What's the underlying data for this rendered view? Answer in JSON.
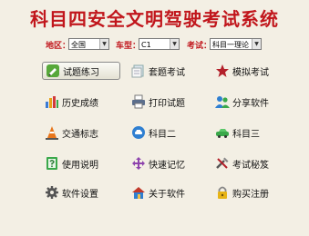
{
  "title": "科目四安全文明驾驶考试系统",
  "selectors": {
    "region_label": "地区：",
    "region_value": "全国",
    "car_label": "车型：",
    "car_value": "C1",
    "exam_label": "考试：",
    "exam_value": "科目一理论"
  },
  "buttons": [
    {
      "label": "试题练习",
      "icon": "pencil-icon"
    },
    {
      "label": "套题考试",
      "icon": "paper-stack-icon"
    },
    {
      "label": "模拟考试",
      "icon": "star-icon"
    },
    {
      "label": "历史成绩",
      "icon": "bar-chart-icon"
    },
    {
      "label": "打印试题",
      "icon": "printer-icon"
    },
    {
      "label": "分享软件",
      "icon": "people-icon"
    },
    {
      "label": "交通标志",
      "icon": "traffic-cone-icon"
    },
    {
      "label": "科目二",
      "icon": "car-icon"
    },
    {
      "label": "科目三",
      "icon": "green-car-icon"
    },
    {
      "label": "使用说明",
      "icon": "help-book-icon"
    },
    {
      "label": "快速记忆",
      "icon": "arrows-icon"
    },
    {
      "label": "考试秘笈",
      "icon": "tools-icon"
    },
    {
      "label": "软件设置",
      "icon": "gear-icon"
    },
    {
      "label": "关于软件",
      "icon": "house-icon"
    },
    {
      "label": "购买注册",
      "icon": "lock-icon"
    }
  ],
  "colors": {
    "background": "#f3efe4",
    "title": "#c1161c",
    "label": "#c1161c"
  }
}
